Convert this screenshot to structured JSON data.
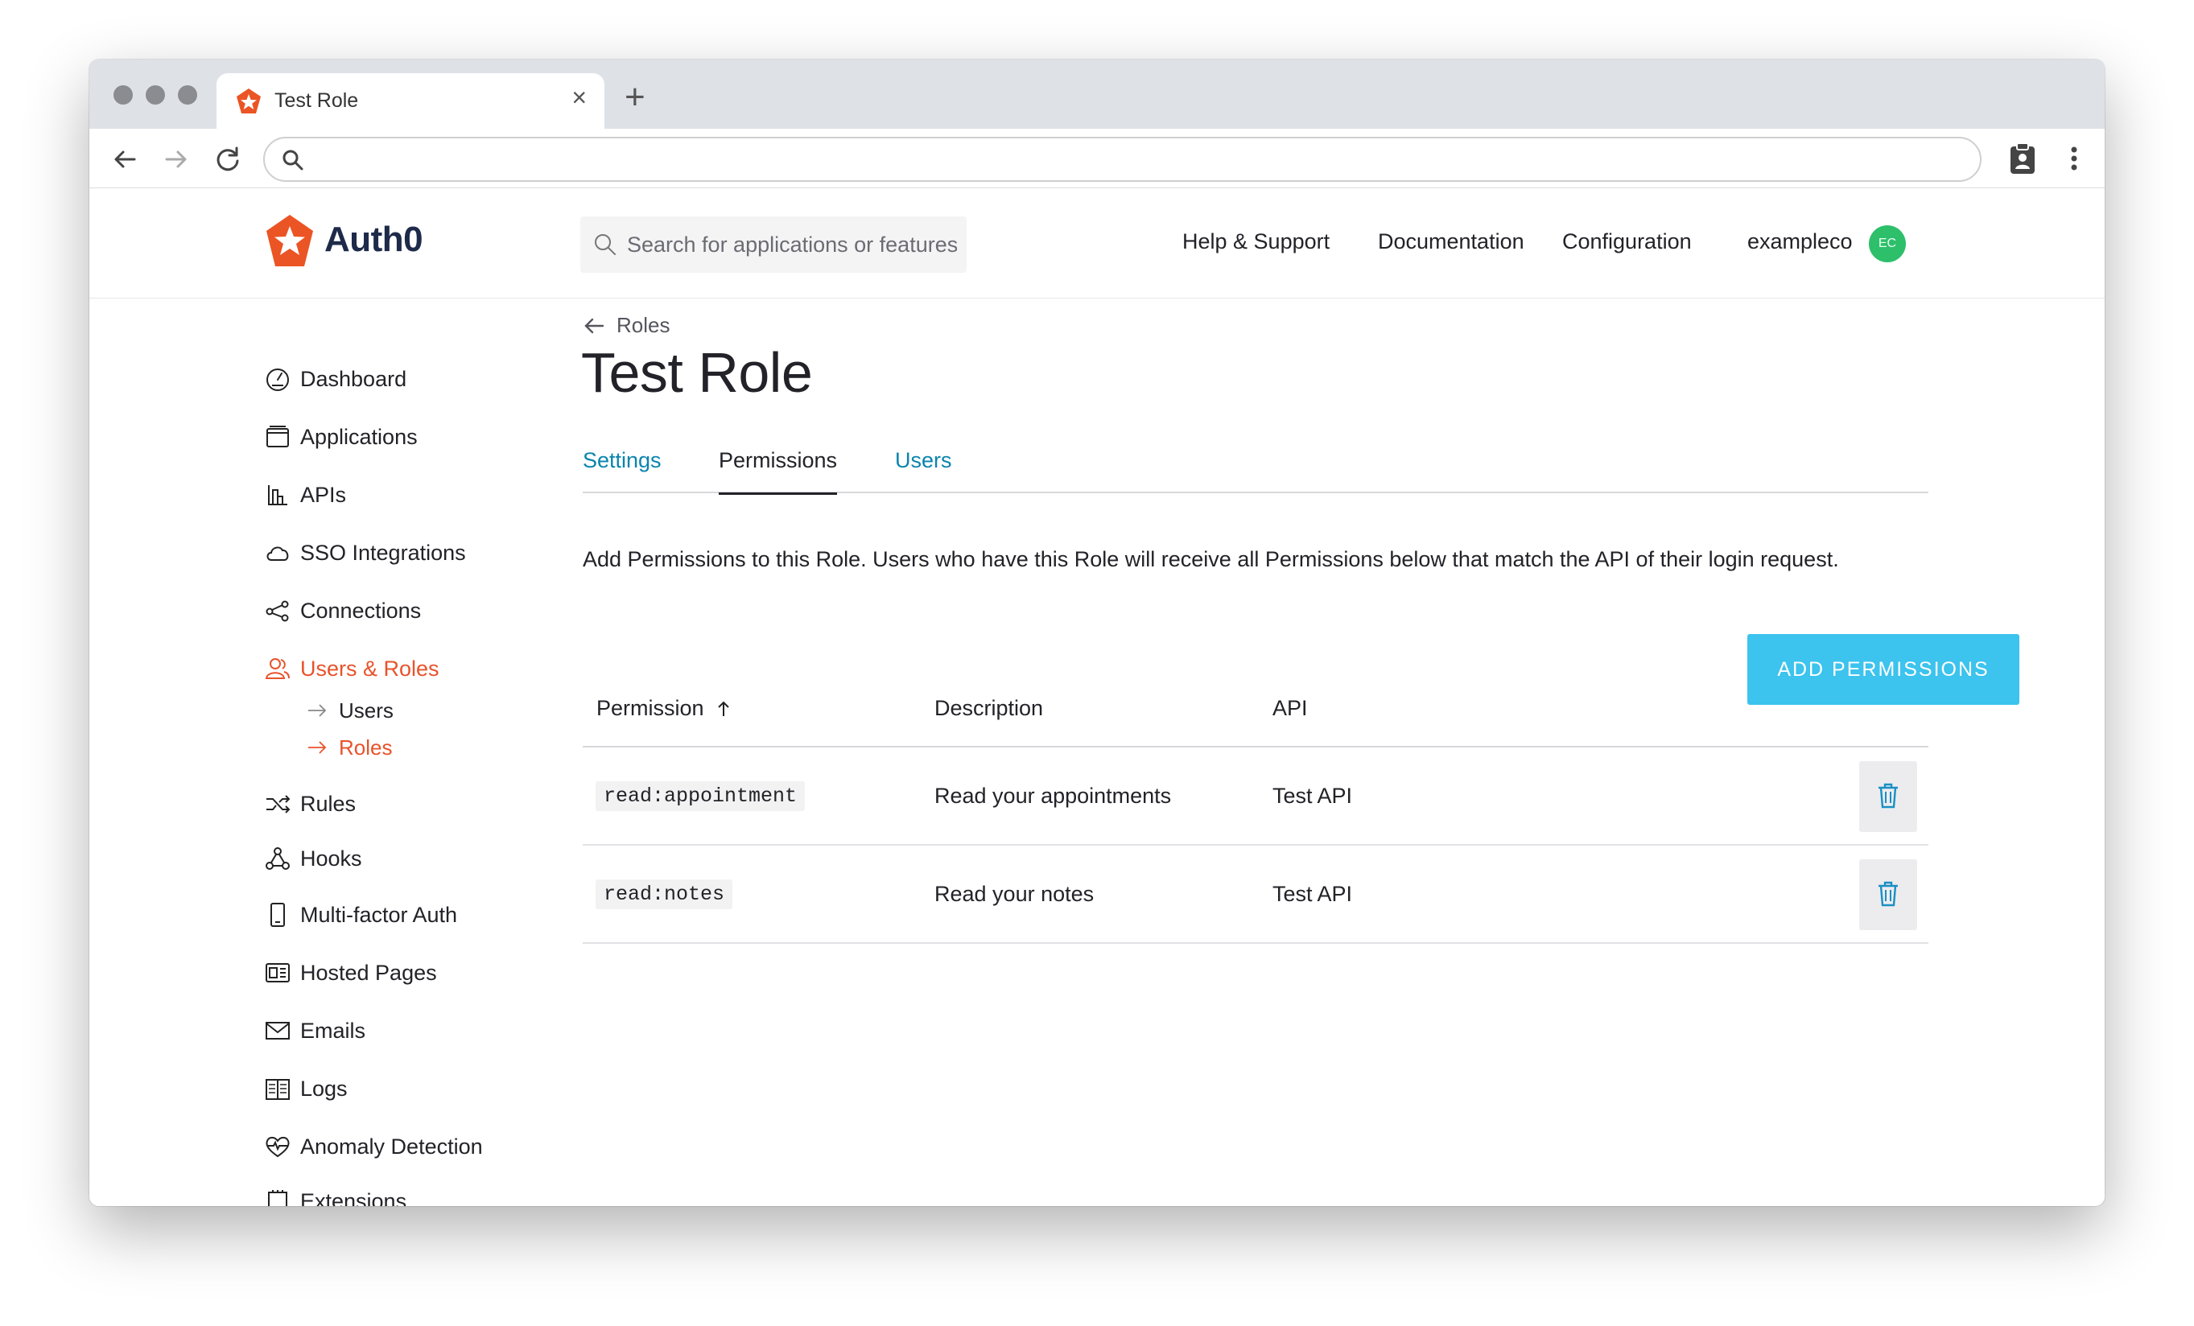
{
  "browser": {
    "tab_title": "Test Role",
    "tab_close": "×",
    "new_tab": "+",
    "address_value": ""
  },
  "header": {
    "logo_text": "Auth0",
    "search_placeholder": "Search for applications or features",
    "nav": [
      "Help & Support",
      "Documentation",
      "Configuration"
    ],
    "tenant": "exampleco",
    "avatar_initials": "EC"
  },
  "sidebar": {
    "items": [
      {
        "label": "Dashboard",
        "icon": "dashboard-icon"
      },
      {
        "label": "Applications",
        "icon": "applications-icon"
      },
      {
        "label": "APIs",
        "icon": "apis-icon"
      },
      {
        "label": "SSO Integrations",
        "icon": "cloud-icon"
      },
      {
        "label": "Connections",
        "icon": "connections-icon"
      },
      {
        "label": "Users & Roles",
        "icon": "users-icon",
        "active": true
      },
      {
        "label": "Rules",
        "icon": "rules-icon"
      },
      {
        "label": "Hooks",
        "icon": "hooks-icon"
      },
      {
        "label": "Multi-factor Auth",
        "icon": "phone-icon"
      },
      {
        "label": "Hosted Pages",
        "icon": "hosted-pages-icon"
      },
      {
        "label": "Emails",
        "icon": "mail-icon"
      },
      {
        "label": "Logs",
        "icon": "logs-icon"
      },
      {
        "label": "Anomaly Detection",
        "icon": "heart-icon"
      },
      {
        "label": "Extensions",
        "icon": "extensions-icon"
      }
    ],
    "sub_items": [
      {
        "label": "Users",
        "active": false
      },
      {
        "label": "Roles",
        "active": true
      }
    ]
  },
  "main": {
    "breadcrumb": "Roles",
    "title": "Test Role",
    "tabs": [
      {
        "label": "Settings",
        "active": false
      },
      {
        "label": "Permissions",
        "active": true
      },
      {
        "label": "Users",
        "active": false
      }
    ],
    "intro": "Add Permissions to this Role. Users who have this Role will receive all Permissions below that match the API of their login request.",
    "add_button": "ADD PERMISSIONS",
    "table": {
      "columns": [
        "Permission",
        "Description",
        "API"
      ],
      "sort": "ascending",
      "rows": [
        {
          "permission": "read:appointment",
          "description": "Read your appointments",
          "api": "Test API"
        },
        {
          "permission": "read:notes",
          "description": "Read your notes",
          "api": "Test API"
        }
      ]
    }
  },
  "colors": {
    "accent": "#e8532b",
    "link": "#0a84ae",
    "button": "#3cc3ee",
    "avatar": "#2dbf6a"
  }
}
